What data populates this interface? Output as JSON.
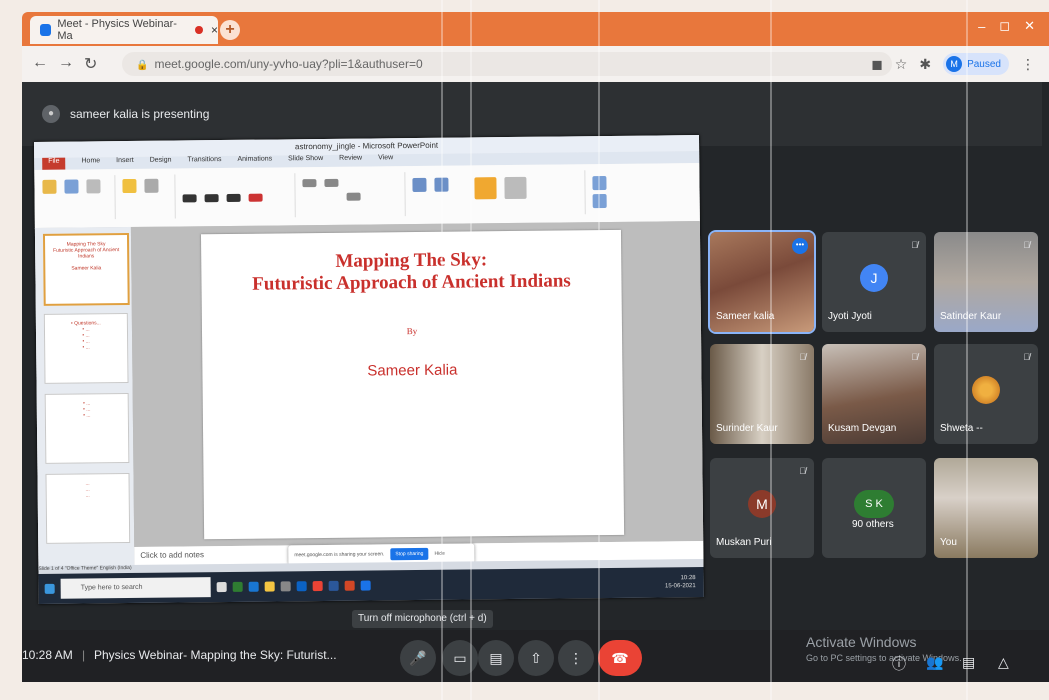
{
  "browser": {
    "tab_title": "Meet - Physics Webinar- Ma",
    "tab_close": "×",
    "new_tab": "+",
    "url": "meet.google.com/uny-yvho-uay?pli=1&authuser=0",
    "profile_initial": "M",
    "profile_status": "Paused",
    "window_controls": [
      "–",
      "◻",
      "✕"
    ]
  },
  "meet": {
    "presenting_text": "sameer kalia is presenting",
    "tooltip": "Turn off microphone (ctrl + d)",
    "time": "10:28 AM",
    "separator": "|",
    "meeting_title": "Physics Webinar- Mapping the Sky: Futurist...",
    "watermark_title": "Activate Windows",
    "watermark_sub": "Go to PC settings to activate Windows.",
    "participants": [
      {
        "name": "Sameer kalia",
        "type": "photo",
        "active": true
      },
      {
        "name": "Jyoti Jyoti",
        "initial": "J",
        "avatar_color": "#4285f4"
      },
      {
        "name": "Satinder Kaur",
        "type": "photo"
      },
      {
        "name": "Surinder Kaur",
        "type": "photo"
      },
      {
        "name": "Kusam Devgan",
        "type": "photo"
      },
      {
        "name": "Shweta --",
        "type": "photo"
      },
      {
        "name": "Muskan Puri",
        "initial": "M",
        "avatar_color": "#8b3a2a"
      },
      {
        "name": "90 others",
        "initial": "S K",
        "avatar_color": "#2e7d32"
      },
      {
        "name": "You",
        "type": "photo"
      }
    ]
  },
  "presentation": {
    "window_title": "astronomy_jingle - Microsoft PowerPoint",
    "ribbon_tabs": [
      "File",
      "Home",
      "Insert",
      "Design",
      "Transitions",
      "Animations",
      "Slide Show",
      "Review",
      "View"
    ],
    "slide_title_line1": "Mapping The Sky:",
    "slide_title_line2": "Futuristic Approach of Ancient Indians",
    "slide_by": "By",
    "slide_author": "Sameer Kalia",
    "notes_placeholder": "Click to add notes",
    "share_notice": "meet.google.com is sharing your screen.",
    "share_stop": "Stop sharing",
    "share_hide": "Hide",
    "status": "Slide 1 of 4   \"Office Theme\"   English (India)",
    "taskbar_search": "Type here to search",
    "taskbar_time": "10:28",
    "taskbar_date": "15-06-2021"
  },
  "colors": {
    "chrome_accent": "#e8773c",
    "meet_bg": "#232629",
    "slide_text": "#c9302c",
    "end_call": "#ea4335"
  }
}
